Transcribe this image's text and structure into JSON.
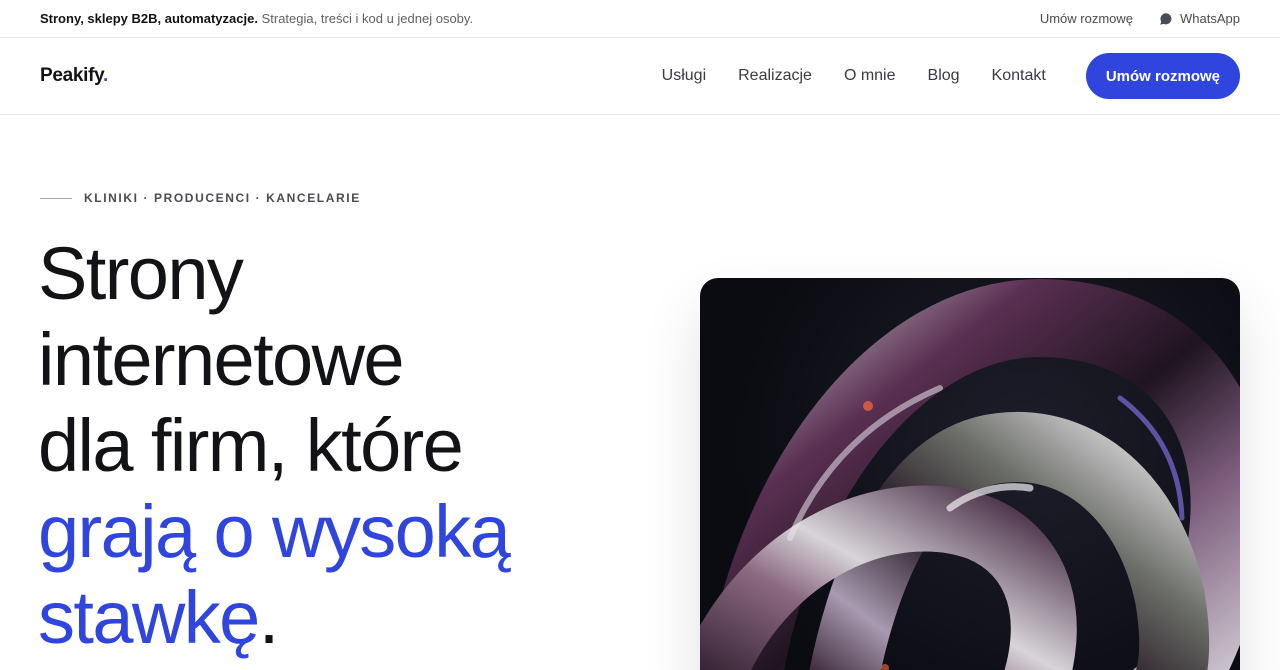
{
  "topbar": {
    "tagline_bold": "Strony, sklepy B2B, automatyzacje.",
    "tagline_rest": "Strategia, treści i kod u jednej osoby.",
    "link_meeting": "Umów rozmowę",
    "link_whatsapp": "WhatsApp",
    "whatsapp_icon": "chat-bubble-icon"
  },
  "nav": {
    "logo": "Peakify",
    "logo_dot": ".",
    "items": [
      {
        "label": "Usługi"
      },
      {
        "label": "Realizacje"
      },
      {
        "label": "O mnie"
      },
      {
        "label": "Blog"
      },
      {
        "label": "Kontakt"
      }
    ],
    "cta_label": "Umów rozmowę"
  },
  "hero": {
    "eyebrow": "KLINIKI · PRODUCENCI · KANCELARIE",
    "title_line1": "Strony",
    "title_line2": "internetowe",
    "title_line3": "dla firm, które",
    "title_line4": "grają o wysoką",
    "title_line5": "stawkę",
    "title_end": "."
  },
  "colors": {
    "accent": "#2f45dd",
    "text": "#121316",
    "muted": "#5f6168"
  }
}
